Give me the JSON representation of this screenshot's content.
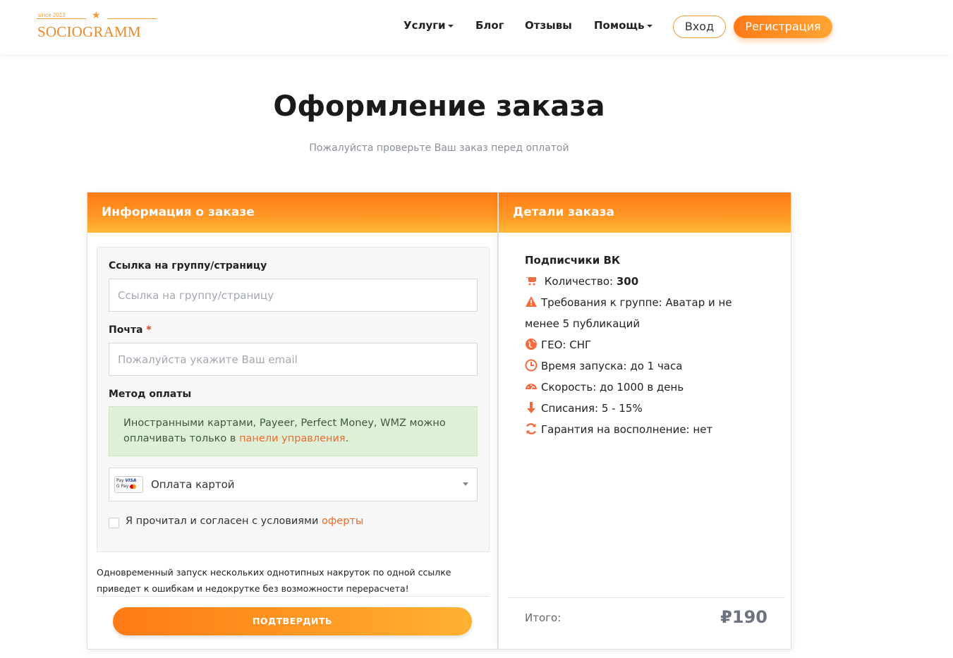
{
  "header": {
    "logo": {
      "since": "since 2013",
      "name": "SOCIOGRAMM"
    },
    "nav": [
      {
        "label": "Услуги",
        "dropdown": true
      },
      {
        "label": "Блог",
        "dropdown": false
      },
      {
        "label": "Отзывы",
        "dropdown": false
      },
      {
        "label": "Помощь",
        "dropdown": true
      }
    ],
    "login_label": "Вход",
    "register_label": "Регистрация"
  },
  "page": {
    "title": "Оформление заказа",
    "subtitle": "Пожалуйста проверьте Ваш заказ перед оплатой"
  },
  "order_info": {
    "heading": "Информация о заказе",
    "link_label": "Ссылка на группу/страницу",
    "link_placeholder": "Ссылка на группу/страницу",
    "email_label": "Почта",
    "email_required_mark": "*",
    "email_placeholder": "Пожалуйста укажите Ваш email",
    "payment_label": "Метод оплаты",
    "alert_text": "Иностранными картами, Payeer, Perfect Money, WMZ можно оплачивать только в ",
    "alert_link": "панели управления",
    "alert_end": ".",
    "payment_icon": {
      "line1": "Pay",
      "visa": "VISA",
      "line2": "G Pay"
    },
    "payment_selected": "Оплата картой",
    "agree_text": "Я прочитал и согласен с условиями ",
    "agree_link": "оферты",
    "warning": "Одновременный запуск нескольких однотипных накруток по одной ссылке приведет к ошибкам и недокрутке без возможности перерасчета!",
    "confirm_label": "ПОДТВЕРДИТЬ"
  },
  "order_details": {
    "heading": "Детали заказа",
    "service": "Подписчики ВК",
    "quantity_label": "Количество:",
    "quantity_value": "300",
    "requirements": "Требования к группе: Аватар и не менее 5 публикаций",
    "geo": "ГЕО: СНГ",
    "start_time": "Время запуска: до 1 часа",
    "speed": "Скорость: до 1000 в день",
    "drop": "Списания: 5 - 15%",
    "guarantee": "Гарантия на восполнение: нет",
    "total_label": "Итого:",
    "total_value": "₽190"
  },
  "colors": {
    "accent": "#ff7a18",
    "accent_light": "#ffb232",
    "link": "#f06a2a",
    "icon": "#f26a3d"
  }
}
